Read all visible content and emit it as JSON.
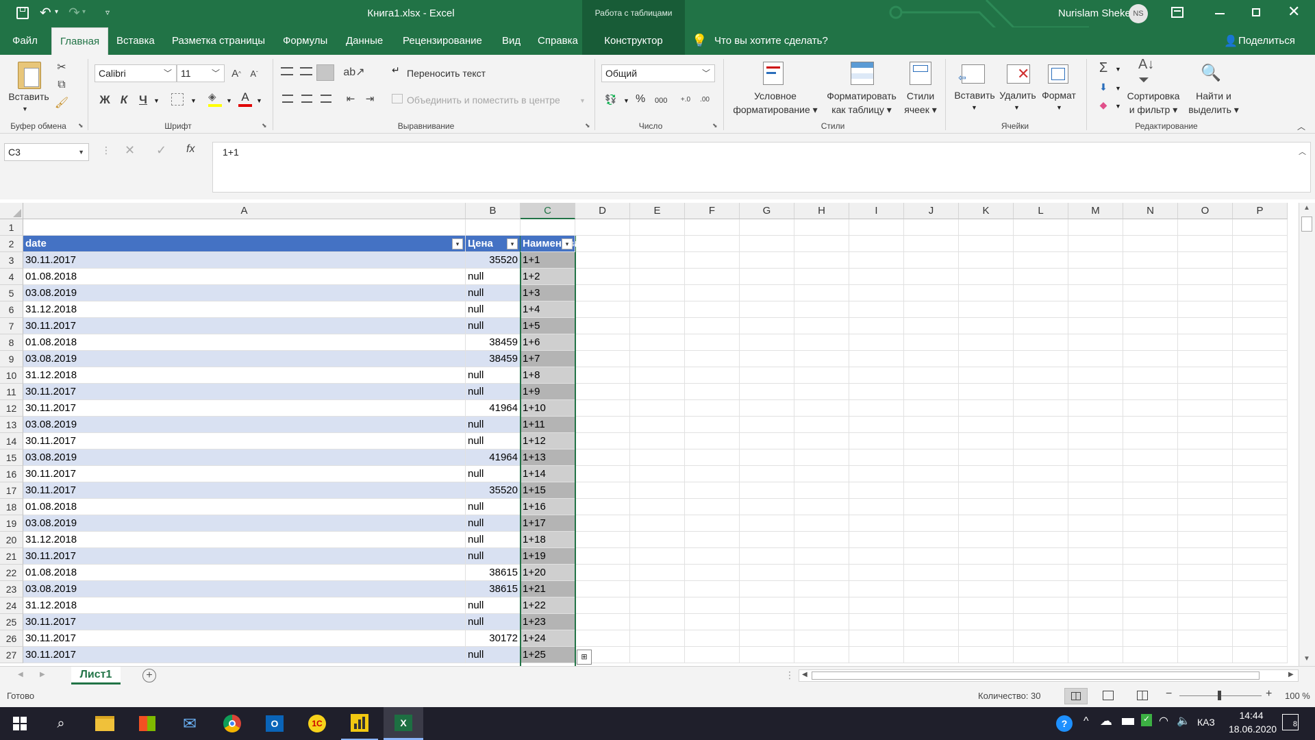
{
  "title": {
    "document": "Книга1.xlsx  -  Excel",
    "context_tab": "Работа с таблицами",
    "user": "Nurislam Shekerov",
    "user_initials": "NS"
  },
  "menu": {
    "tabs": [
      "Файл",
      "Главная",
      "Вставка",
      "Разметка страницы",
      "Формулы",
      "Данные",
      "Рецензирование",
      "Вид",
      "Справка",
      "Конструктор"
    ],
    "active": "Главная",
    "search": "Что вы хотите сделать?",
    "share": "Поделиться"
  },
  "ribbon": {
    "clipboard": {
      "paste": "Вставить",
      "label": "Буфер обмена"
    },
    "font": {
      "name": "Calibri",
      "size": "11",
      "bold": "Ж",
      "italic": "К",
      "underline": "Ч",
      "label": "Шрифт"
    },
    "alignment": {
      "wrap": "Переносить текст",
      "merge": "Объединить и поместить в центре",
      "label": "Выравнивание"
    },
    "number": {
      "format": "Общий",
      "percent": "%",
      "thousands": "000",
      "label": "Число"
    },
    "styles": {
      "conditional": "Условное\nформатирование",
      "as_table": "Форматировать\nкак таблицу",
      "cell_styles": "Стили\nячеек",
      "label": "Стили"
    },
    "cells": {
      "insert": "Вставить",
      "delete": "Удалить",
      "format": "Формат",
      "label": "Ячейки"
    },
    "editing": {
      "sort": "Сортировка\nи фильтр",
      "find": "Найти и\nвыделить",
      "label": "Редактирование"
    }
  },
  "formula_bar": {
    "name_box": "C3",
    "formula": "1+1",
    "fx": "fx"
  },
  "grid": {
    "columns": [
      "A",
      "B",
      "C",
      "D",
      "E",
      "F",
      "G",
      "H",
      "I",
      "J",
      "K",
      "L",
      "M",
      "N",
      "O",
      "P"
    ],
    "selected_column": "C",
    "headers": {
      "a": "date",
      "b": "Цена",
      "c": "Наименование"
    },
    "rows": [
      {
        "n": "1",
        "a": "",
        "b": "",
        "c": ""
      },
      {
        "n": "2",
        "a": "date",
        "b": "Цена",
        "c": "Наименование"
      },
      {
        "n": "3",
        "a": "30.11.2017",
        "b": "35520",
        "c": "1+1"
      },
      {
        "n": "4",
        "a": "01.08.2018",
        "b": "null",
        "c": "1+2"
      },
      {
        "n": "5",
        "a": "03.08.2019",
        "b": "null",
        "c": "1+3"
      },
      {
        "n": "6",
        "a": "31.12.2018",
        "b": "null",
        "c": "1+4"
      },
      {
        "n": "7",
        "a": "30.11.2017",
        "b": "null",
        "c": "1+5"
      },
      {
        "n": "8",
        "a": "01.08.2018",
        "b": "38459",
        "c": "1+6"
      },
      {
        "n": "9",
        "a": "03.08.2019",
        "b": "38459",
        "c": "1+7"
      },
      {
        "n": "10",
        "a": "31.12.2018",
        "b": "null",
        "c": "1+8"
      },
      {
        "n": "11",
        "a": "30.11.2017",
        "b": "null",
        "c": "1+9"
      },
      {
        "n": "12",
        "a": "30.11.2017",
        "b": "41964",
        "c": "1+10"
      },
      {
        "n": "13",
        "a": "03.08.2019",
        "b": "null",
        "c": "1+11"
      },
      {
        "n": "14",
        "a": "30.11.2017",
        "b": "null",
        "c": "1+12"
      },
      {
        "n": "15",
        "a": "03.08.2019",
        "b": "41964",
        "c": "1+13"
      },
      {
        "n": "16",
        "a": "30.11.2017",
        "b": "null",
        "c": "1+14"
      },
      {
        "n": "17",
        "a": "30.11.2017",
        "b": "35520",
        "c": "1+15"
      },
      {
        "n": "18",
        "a": "01.08.2018",
        "b": "null",
        "c": "1+16"
      },
      {
        "n": "19",
        "a": "03.08.2019",
        "b": "null",
        "c": "1+17"
      },
      {
        "n": "20",
        "a": "31.12.2018",
        "b": "null",
        "c": "1+18"
      },
      {
        "n": "21",
        "a": "30.11.2017",
        "b": "null",
        "c": "1+19"
      },
      {
        "n": "22",
        "a": "01.08.2018",
        "b": "38615",
        "c": "1+20"
      },
      {
        "n": "23",
        "a": "03.08.2019",
        "b": "38615",
        "c": "1+21"
      },
      {
        "n": "24",
        "a": "31.12.2018",
        "b": "null",
        "c": "1+22"
      },
      {
        "n": "25",
        "a": "30.11.2017",
        "b": "null",
        "c": "1+23"
      },
      {
        "n": "26",
        "a": "30.11.2017",
        "b": "30172",
        "c": "1+24"
      },
      {
        "n": "27",
        "a": "30.11.2017",
        "b": "null",
        "c": "1+25"
      }
    ]
  },
  "sheets": {
    "active": "Лист1"
  },
  "status": {
    "ready": "Готово",
    "count": "Количество: 30",
    "zoom": "100 %"
  },
  "taskbar": {
    "lang": "КАЗ",
    "time": "14:44",
    "date": "18.06.2020",
    "notifications": "8"
  },
  "colors": {
    "accent": "#217346",
    "table_header": "#4472c4",
    "band": "#d9e1f2"
  }
}
